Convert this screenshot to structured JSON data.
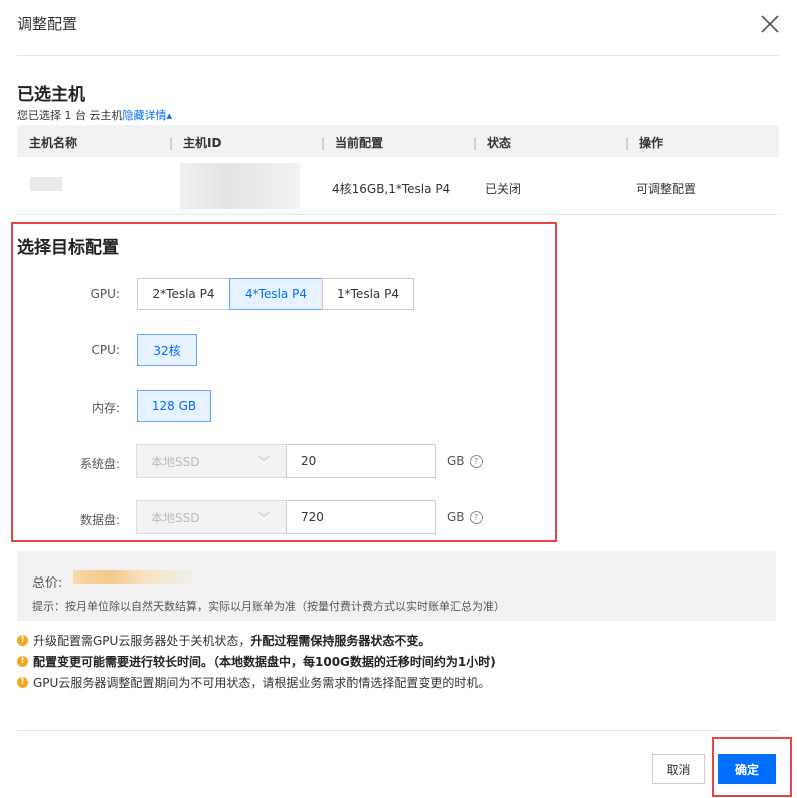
{
  "dialog": {
    "title": "调整配置"
  },
  "selected_hosts": {
    "heading": "已选主机",
    "summary_prefix": "您已选择 1 台 云主机",
    "toggle_link": "隐藏详情",
    "columns": [
      "主机名称",
      "主机ID",
      "当前配置",
      "状态",
      "操作"
    ],
    "row": {
      "config": "4核16GB,1*Tesla P4",
      "status": "已关闭",
      "action": "可调整配置"
    }
  },
  "target": {
    "heading": "选择目标配置",
    "gpu_label": "GPU:",
    "gpu_options": [
      "2*Tesla P4",
      "4*Tesla P4",
      "1*Tesla P4"
    ],
    "gpu_selected": "4*Tesla P4",
    "cpu_label": "CPU:",
    "cpu_value": "32核",
    "mem_label": "内存:",
    "mem_value": "128 GB",
    "sys_disk_label": "系统盘:",
    "sys_disk_type": "本地SSD",
    "sys_disk_size": "20",
    "data_disk_label": "数据盘:",
    "data_disk_type": "本地SSD",
    "data_disk_size": "720",
    "unit": "GB"
  },
  "price": {
    "label": "总价:",
    "tip": "提示：按月单位除以自然天数结算，实际以月账单为准（按量付费计费方式以实时账单汇总为准）"
  },
  "warnings": [
    {
      "normal": "升级配置需GPU云服务器处于关机状态，",
      "bold": "升配过程需保持服务器状态不变。"
    },
    {
      "normal": "",
      "bold": "配置变更可能需要进行较长时间。（本地数据盘中，每100G数据的迁移时间约为1小时)"
    },
    {
      "normal": "GPU云服务器调整配置期间为不可用状态，请根据业务需求酌情选择配置变更的时机。",
      "bold": ""
    }
  ],
  "footer": {
    "cancel": "取消",
    "confirm": "确定"
  },
  "colors": {
    "primary": "#006eff",
    "highlight_border": "#e54545",
    "warning": "#f5a623"
  }
}
